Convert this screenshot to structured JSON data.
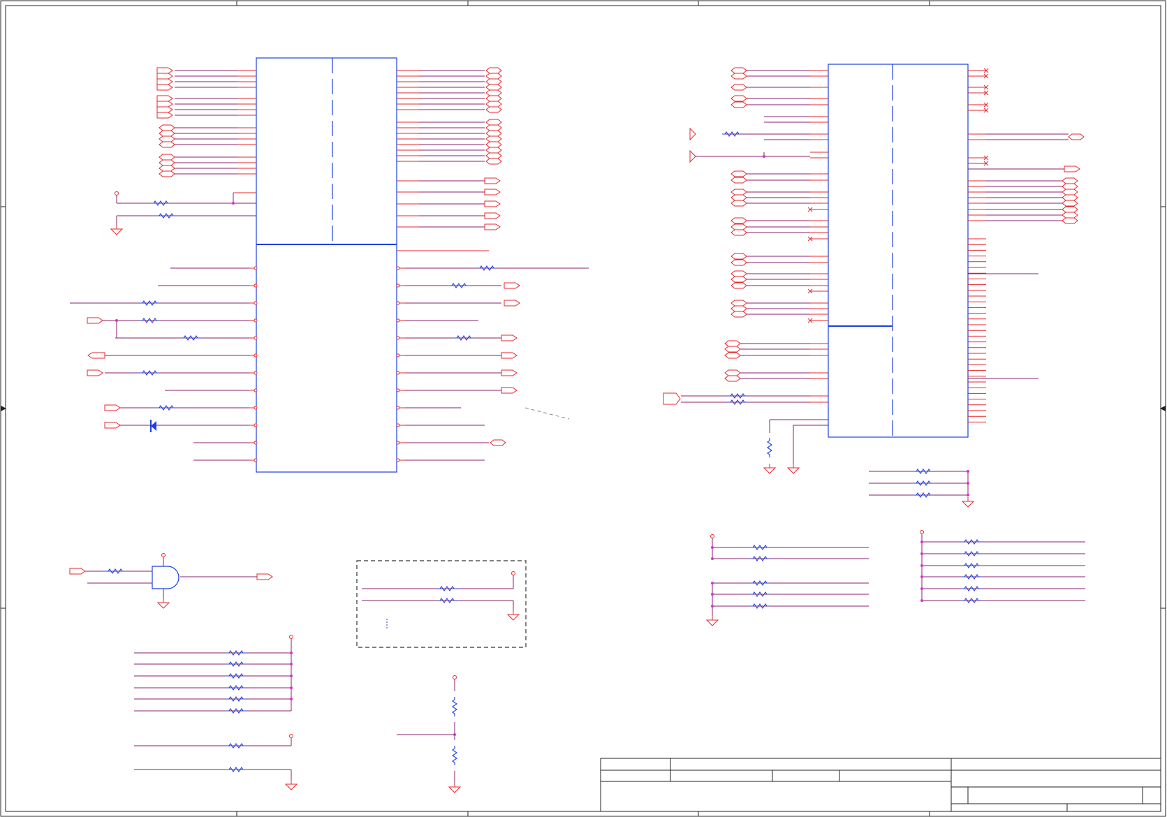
{
  "title_block": {},
  "colors": {
    "wire": "#8a1f6e",
    "pin": "#e8262b",
    "body": "#1c3fe0",
    "border": "#222222",
    "junction": "#d92fd0",
    "dashed": "#333333"
  }
}
